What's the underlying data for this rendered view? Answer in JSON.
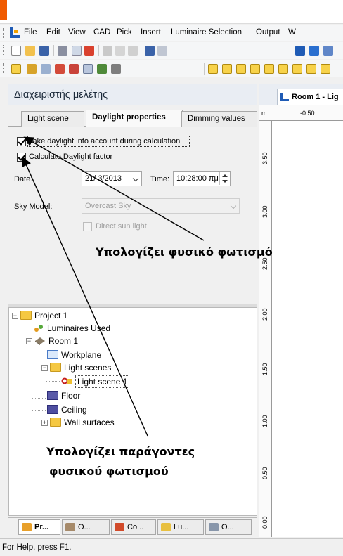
{
  "colors": {
    "accent_orange": "#f05a00",
    "panel_header_bg": "#e9edf3",
    "folder_yellow": "#f5c842"
  },
  "menu": {
    "items": [
      "File",
      "Edit",
      "View",
      "CAD",
      "Pick",
      "Insert",
      "Luminaire Selection",
      "Output",
      "W"
    ]
  },
  "panel": {
    "title": "Διαχειριστής μελέτης"
  },
  "tabs": {
    "light_scene": "Light scene",
    "daylight_properties": "Daylight properties",
    "dimming_values": "Dimming values"
  },
  "daylight": {
    "take_daylight": {
      "label": "Take daylight into account during calculation",
      "checked": true
    },
    "calc_factor": {
      "label": "Calculate Daylight factor",
      "checked": true
    },
    "date_label": "Date:",
    "date_value": "21/ 3/2013",
    "time_label": "Time:",
    "time_value": "10:28:00 πμ",
    "sky_model_label": "Sky Model:",
    "sky_model_value": "Overcast Sky",
    "direct_sun": {
      "label": "Direct sun light",
      "checked": false
    }
  },
  "tree": {
    "items": [
      {
        "label": "Project 1",
        "icon": "folder-icon"
      },
      {
        "label": "Luminaires Used",
        "icon": "luminaires-icon"
      },
      {
        "label": "Room 1",
        "icon": "room-icon"
      },
      {
        "label": "Workplane",
        "icon": "workplane-icon"
      },
      {
        "label": "Light scenes",
        "icon": "folder-icon"
      },
      {
        "label": "Light scene 1",
        "icon": "light-scene-icon",
        "selected": true
      },
      {
        "label": "Floor",
        "icon": "floor-icon"
      },
      {
        "label": "Ceiling",
        "icon": "ceiling-icon"
      },
      {
        "label": "Wall surfaces",
        "icon": "folder-icon"
      }
    ]
  },
  "bottom_tabs": [
    "Pr...",
    "O...",
    "Co...",
    "Lu...",
    "O..."
  ],
  "document": {
    "tab_title": "Room 1 - Lig",
    "ruler_unit": "m",
    "top_tick": "-0.50",
    "left_ticks": [
      "3.50",
      "3.00",
      "2.50",
      "2.00",
      "1.50",
      "1.00",
      "0.50",
      "0.00"
    ]
  },
  "status": {
    "text": "For Help, press F1."
  },
  "annotations": {
    "top": "Υπολογίζει φυσικό φωτισμό",
    "bottom_line1": "Υπολογίζει  παράγοντες",
    "bottom_line2": "φυσικού φωτισμού"
  }
}
